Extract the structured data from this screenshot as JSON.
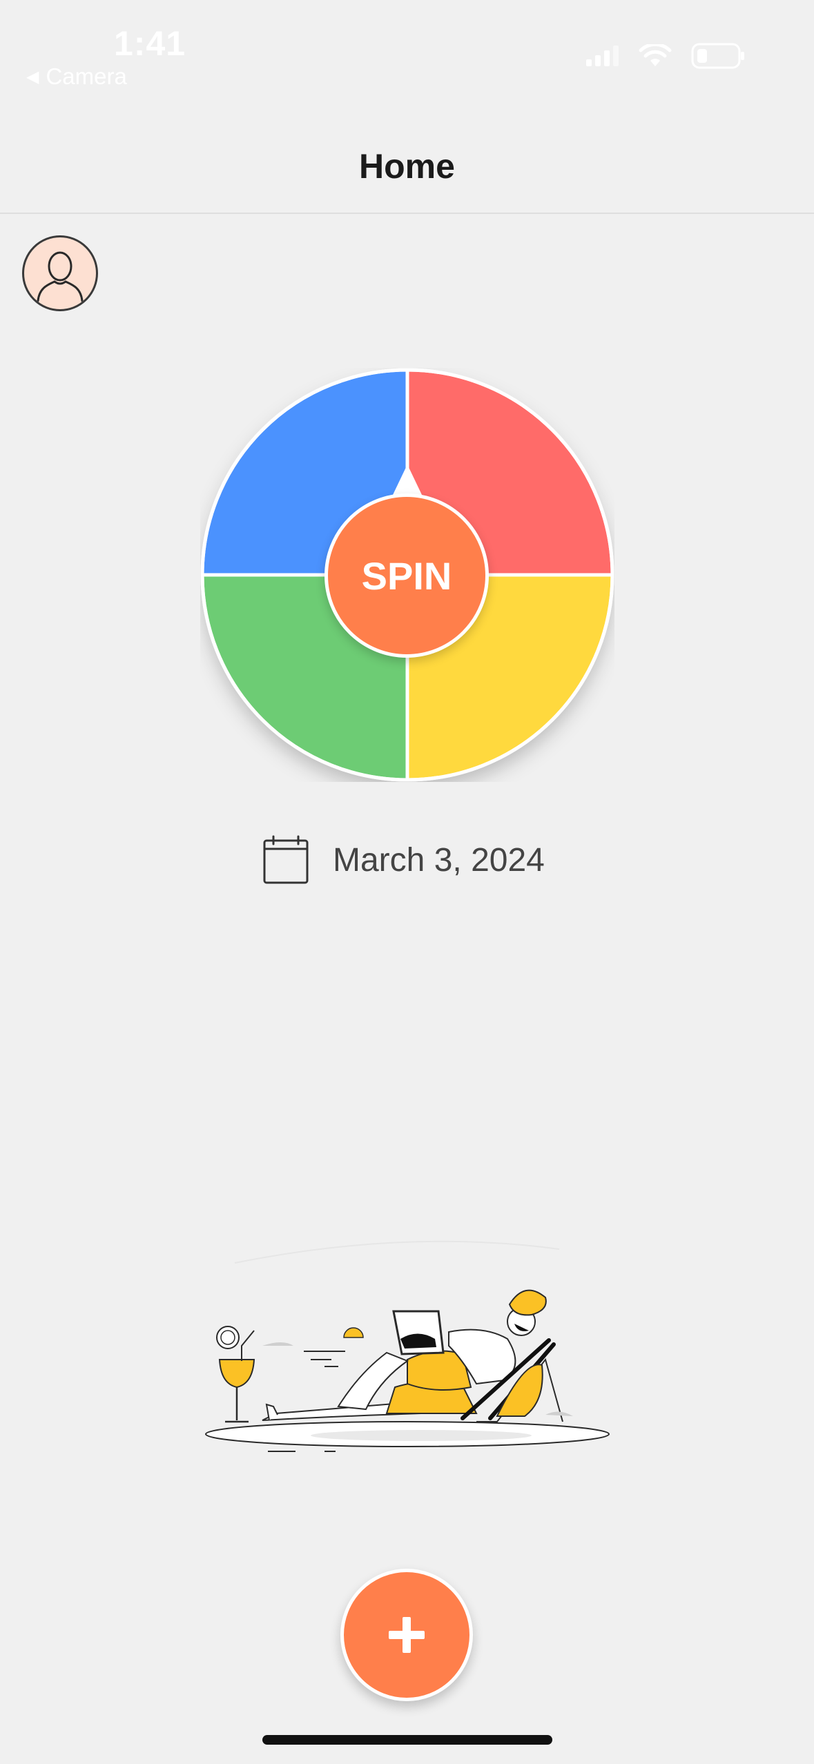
{
  "status_bar": {
    "time": "1:41",
    "back_label": "Camera",
    "icons": [
      "cellular-signal-icon",
      "wifi-icon",
      "battery-icon"
    ]
  },
  "nav": {
    "title": "Home"
  },
  "wheel": {
    "segments": [
      {
        "color": "#4b92fe"
      },
      {
        "color": "#ff6b69"
      },
      {
        "color": "#6dcc74"
      },
      {
        "color": "#ffd93e"
      }
    ],
    "spin_label": "SPIN",
    "spin_color": "#ff7f4b"
  },
  "date": {
    "text": "March 3, 2024",
    "icon": "calendar-icon"
  },
  "fab": {
    "label": "+",
    "icon": "plus-icon"
  },
  "colors": {
    "accent": "#ff7f4b",
    "background": "#f0f0f0",
    "avatar_bg": "#fde0d2"
  }
}
